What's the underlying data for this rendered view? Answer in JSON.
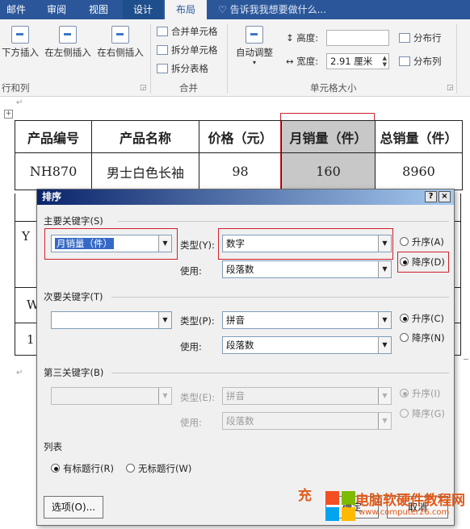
{
  "ribbon": {
    "tabs": [
      "邮件",
      "审阅",
      "视图",
      "设计",
      "布局"
    ],
    "tell_me": "告诉我我想要做什么...",
    "buttons": {
      "insert_below": "下方插入",
      "insert_left": "在左侧插入",
      "insert_right": "在右侧插入",
      "merge_cells": "合并单元格",
      "split_cells": "拆分单元格",
      "split_table": "拆分表格",
      "autofit": "自动调整",
      "height_label": "高度:",
      "height_value": "",
      "width_label": "宽度:",
      "width_value": "2.91 厘米",
      "distribute_rows": "分布行",
      "distribute_cols": "分布列"
    },
    "groups": {
      "rows_cols": "行和列",
      "merge": "合并",
      "cell_size": "单元格大小"
    }
  },
  "document": {
    "table": {
      "headers": [
        "产品编号",
        "产品名称",
        "价格（元）",
        "月销量（件）",
        "总销量（件）"
      ],
      "rows": [
        [
          "NH870",
          "男士白色长袖",
          "98",
          "160",
          "8960"
        ]
      ],
      "partial_row_fragments": [
        "Y",
        "W",
        "1"
      ]
    }
  },
  "dialog": {
    "title": "排序",
    "help": "?",
    "close": "×",
    "primary": {
      "section": "主要关键字(S)",
      "key": "月销量（件）",
      "type_label": "类型(Y):",
      "type": "数字",
      "use_label": "使用:",
      "use": "段落数",
      "asc": "升序(A)",
      "desc": "降序(D)"
    },
    "secondary": {
      "section": "次要关键字(T)",
      "key": "",
      "type_label": "类型(P):",
      "type": "拼音",
      "use_label": "使用:",
      "use": "段落数",
      "asc": "升序(C)",
      "desc": "降序(N)"
    },
    "tertiary": {
      "section": "第三关键字(B)",
      "key": "",
      "type_label": "类型(E):",
      "type": "拼音",
      "use_label": "使用:",
      "use": "段落数",
      "asc": "升序(I)",
      "desc": "降序(G)"
    },
    "list": {
      "section": "列表",
      "has_header": "有标题行(R)",
      "no_header": "无标题行(W)"
    },
    "buttons": {
      "options": "选项(O)...",
      "ok": "确定",
      "cancel": "取消"
    }
  },
  "watermark": {
    "site_name": "电脑软硬件教程网",
    "url": "www.computer26.com",
    "partial_char": "充"
  }
}
